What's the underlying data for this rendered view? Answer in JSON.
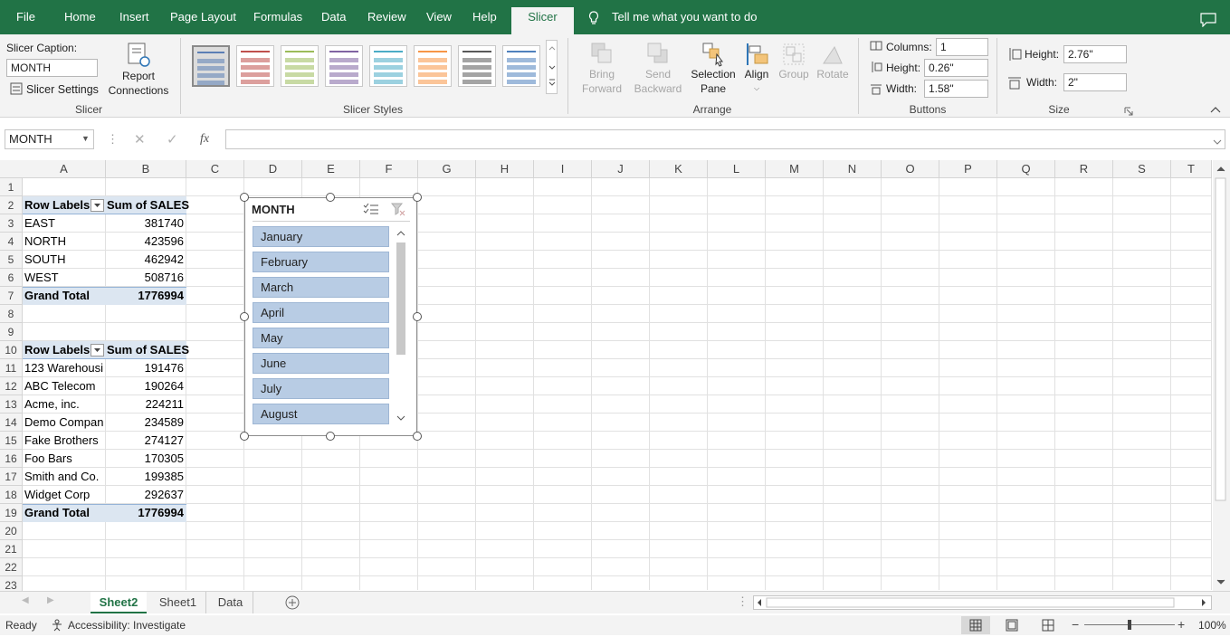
{
  "tabs": {
    "file": "File",
    "home": "Home",
    "insert": "Insert",
    "page_layout": "Page Layout",
    "formulas": "Formulas",
    "data": "Data",
    "review": "Review",
    "view": "View",
    "help": "Help",
    "slicer": "Slicer",
    "tell_me": "Tell me what you want to do"
  },
  "ribbon": {
    "slicer_caption_label": "Slicer Caption:",
    "slicer_caption_value": "MONTH",
    "slicer_settings": "Slicer Settings",
    "report_connections_1": "Report",
    "report_connections_2": "Connections",
    "group_slicer": "Slicer",
    "group_styles": "Slicer Styles",
    "bring_forward_1": "Bring",
    "bring_forward_2": "Forward",
    "send_backward_1": "Send",
    "send_backward_2": "Backward",
    "selection_pane_1": "Selection",
    "selection_pane_2": "Pane",
    "align": "Align",
    "group": "Group",
    "rotate": "Rotate",
    "group_arrange": "Arrange",
    "columns_label": "Columns:",
    "columns_value": "1",
    "btn_height_label": "Height:",
    "btn_height_value": "0.26\"",
    "btn_width_label": "Width:",
    "btn_width_value": "1.58\"",
    "group_buttons": "Buttons",
    "size_height_label": "Height:",
    "size_height_value": "2.76\"",
    "size_width_label": "Width:",
    "size_width_value": "2\"",
    "group_size": "Size"
  },
  "style_colors": [
    "#5b7fb5",
    "#c0504d",
    "#9bbb59",
    "#8064a2",
    "#4bacc6",
    "#f79646",
    "#595959",
    "#4f81bd"
  ],
  "formula_bar": {
    "name_box": "MONTH",
    "fx": "fx",
    "formula": ""
  },
  "columns": [
    "A",
    "B",
    "C",
    "D",
    "E",
    "F",
    "G",
    "H",
    "I",
    "J",
    "K",
    "L",
    "M",
    "N",
    "O",
    "P",
    "Q",
    "R",
    "S",
    "T"
  ],
  "rows": [
    "1",
    "2",
    "3",
    "4",
    "5",
    "6",
    "7",
    "8",
    "9",
    "10",
    "11",
    "12",
    "13",
    "14",
    "15",
    "16",
    "17",
    "18",
    "19",
    "20",
    "21",
    "22",
    "23"
  ],
  "pivot1": {
    "header_a": "Row Labels",
    "header_b": "Sum of SALES",
    "rows": [
      [
        "EAST",
        "381740"
      ],
      [
        "NORTH",
        "423596"
      ],
      [
        "SOUTH",
        "462942"
      ],
      [
        "WEST",
        "508716"
      ]
    ],
    "total_label": "Grand Total",
    "total_value": "1776994"
  },
  "pivot2": {
    "header_a": "Row Labels",
    "header_b": "Sum of SALES",
    "rows": [
      [
        "123 Warehousi",
        "191476"
      ],
      [
        "ABC Telecom",
        "190264"
      ],
      [
        "Acme, inc.",
        "224211"
      ],
      [
        "Demo Compan",
        "234589"
      ],
      [
        "Fake Brothers",
        "274127"
      ],
      [
        "Foo Bars",
        "170305"
      ],
      [
        "Smith and Co.",
        "199385"
      ],
      [
        "Widget Corp",
        "292637"
      ]
    ],
    "total_label": "Grand Total",
    "total_value": "1776994"
  },
  "slicer": {
    "title": "MONTH",
    "items": [
      "January",
      "February",
      "March",
      "April",
      "May",
      "June",
      "July",
      "August"
    ]
  },
  "sheets": {
    "sheet2": "Sheet2",
    "sheet1": "Sheet1",
    "data": "Data"
  },
  "status": {
    "ready": "Ready",
    "accessibility": "Accessibility: Investigate",
    "zoom": "100%"
  }
}
